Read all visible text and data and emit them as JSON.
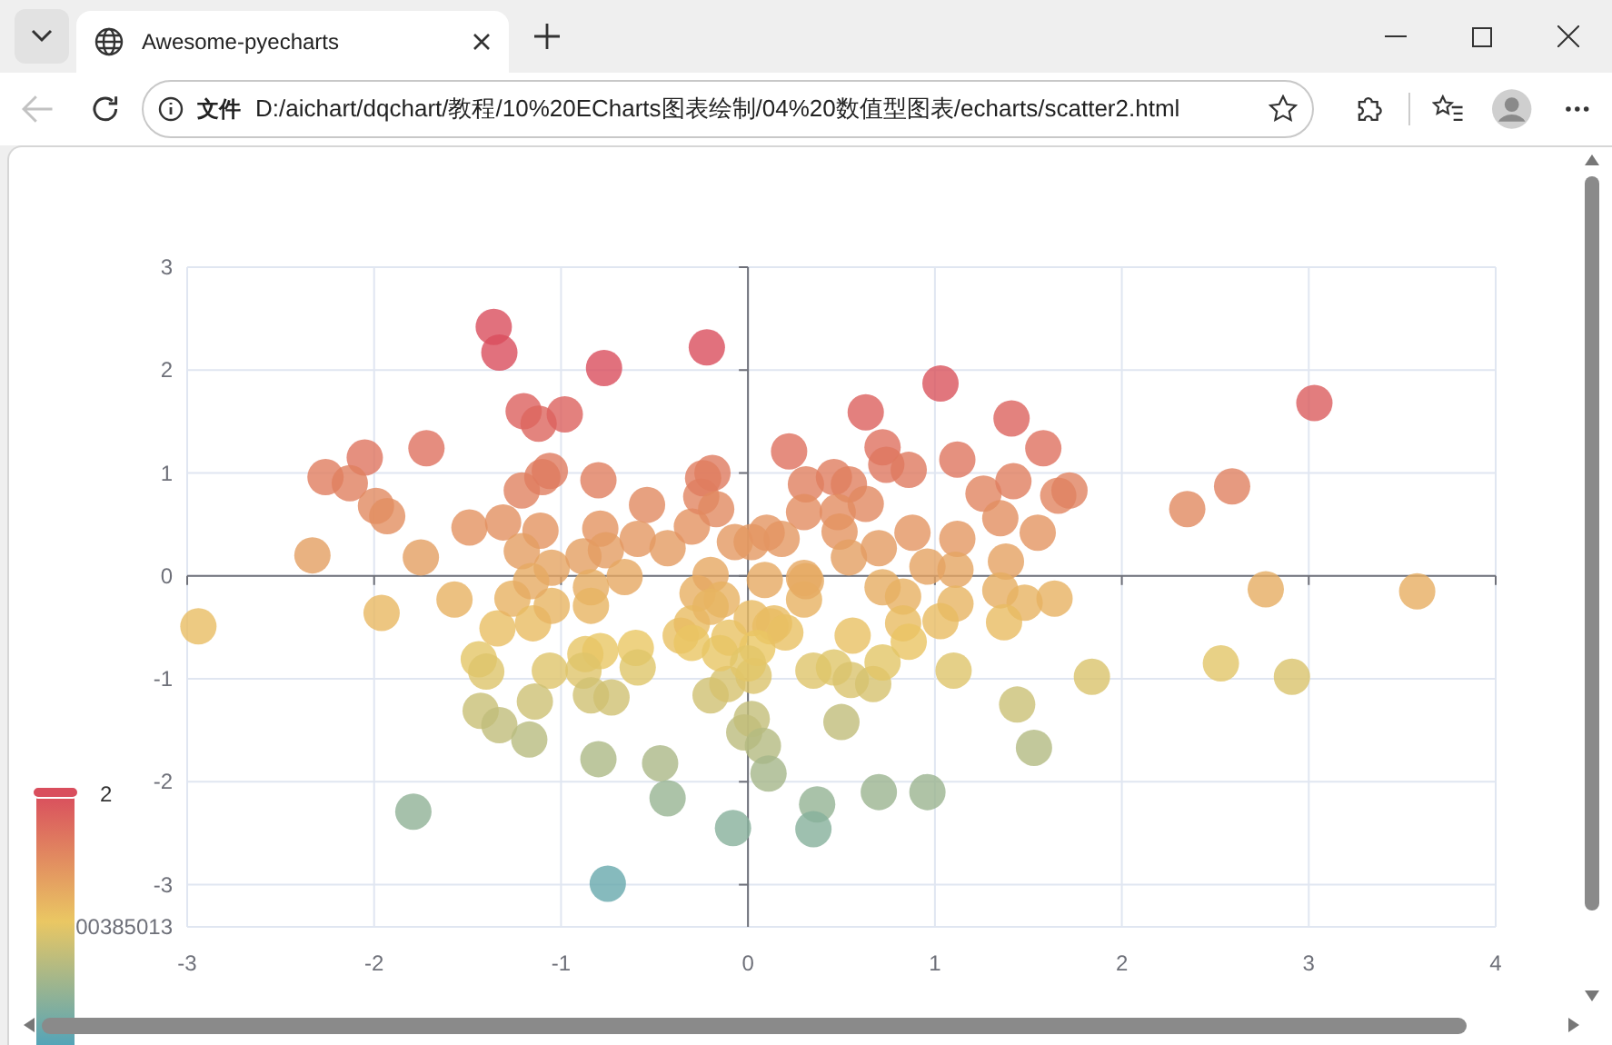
{
  "browser": {
    "tab": {
      "title": "Awesome-pyecharts",
      "selected": true
    },
    "address_bar": {
      "badge": "文件",
      "url": "D:/aichart/dqchart/教程/10%20ECharts图表绘制/04%20数值型图表/echarts/scatter2.html"
    }
  },
  "chart": {
    "visual_map": {
      "label": "2"
    },
    "y_min_label": "00385013",
    "chart_data": {
      "type": "scatter",
      "grid": true,
      "xlim": [
        -3,
        4
      ],
      "ylim": [
        -3.41,
        3
      ],
      "xticks": [
        -3,
        -2,
        -1,
        0,
        1,
        2,
        3,
        4
      ],
      "yticks": [
        -3,
        -2,
        -1,
        0,
        1,
        2,
        3
      ],
      "x": [
        -1.36,
        -1.33,
        -0.77,
        -0.22,
        -1.2,
        -1.12,
        -0.98,
        -2.05,
        -1.72,
        -2.26,
        -2.13,
        -1.99,
        -1.93,
        -2.33,
        -1.75,
        -1.49,
        -1.31,
        -1.21,
        -1.1,
        -1.06,
        -0.8,
        -1.11,
        -1.21,
        -1.05,
        -0.88,
        -0.79,
        -0.76,
        -0.66,
        -0.54,
        -0.59,
        -0.43,
        -0.3,
        -0.25,
        -0.19,
        -0.24,
        -0.17,
        -0.07,
        0.02,
        0.22,
        0.31,
        0.3,
        0.18,
        0.09,
        0.3,
        0.3,
        -2.94,
        -1.96,
        -1.57,
        -1.34,
        -1.26,
        -1.15,
        -1.05,
        -1.16,
        -0.84,
        -0.84,
        -0.27,
        -0.2,
        -0.14,
        0.14,
        0.02,
        -0.36,
        -0.3,
        -0.6,
        -0.79,
        -0.87,
        -1.44,
        -1.4,
        -1.06,
        -0.59,
        0.56,
        0.35,
        1.03,
        3.03,
        0.63,
        1.41,
        1.58,
        0.72,
        0.74,
        0.86,
        1.12,
        0.46,
        0.54,
        0.63,
        1.26,
        1.42,
        1.66,
        1.72,
        1.35,
        1.55,
        2.35,
        2.59,
        0.48,
        0.49,
        0.1,
        0.54,
        0.88,
        1.12,
        1.38,
        0.7,
        1.11,
        0.96,
        0.31,
        0.72,
        0.83,
        1.35,
        1.48,
        1.64,
        2.77,
        3.58,
        1.11,
        1.37,
        1.03,
        0.83,
        0.86,
        0.12,
        1.1,
        1.84,
        2.53,
        2.91,
        0.46,
        -0.88,
        -0.2,
        -0.11,
        0.03,
        0.55,
        0.67,
        0.72,
        -1.43,
        -1.33,
        -1.14,
        -1.17,
        -0.84,
        -0.73,
        -0.02,
        0.02,
        0.08,
        0.11,
        0.5,
        1.44,
        1.53,
        -0.8,
        -0.47,
        -0.43,
        -1.79,
        -0.08,
        0.37,
        0.35,
        0.7,
        0.96,
        -0.75,
        -0.2,
        -0.1,
        0.05,
        -0.3,
        -0.15,
        0,
        0.2
      ],
      "series": [
        {
          "values": [
            2.42,
            2.17,
            2.02,
            2.22,
            1.6,
            1.48,
            1.57,
            1.15,
            1.24,
            0.96,
            0.9,
            0.68,
            0.58,
            0.2,
            0.18,
            0.47,
            0.52,
            0.83,
            0.96,
            1.02,
            0.93,
            0.44,
            0.24,
            0.08,
            0.19,
            0.46,
            0.25,
            -0.01,
            0.69,
            0.36,
            0.27,
            0.48,
            0.77,
            1,
            0.95,
            0.65,
            0.33,
            0.33,
            1.21,
            0.89,
            0.62,
            0.36,
            -0.04,
            -0.02,
            -0.23,
            -0.49,
            -0.36,
            -0.23,
            -0.51,
            -0.22,
            -0.46,
            -0.29,
            -0.05,
            -0.11,
            -0.29,
            -0.17,
            0.01,
            -0.23,
            -0.46,
            -0.41,
            -0.58,
            -0.46,
            -0.7,
            -0.73,
            -0.76,
            -0.81,
            -0.93,
            -0.92,
            -0.89,
            -0.58,
            -0.92,
            1.87,
            1.68,
            1.59,
            1.53,
            1.24,
            1.25,
            1.08,
            1.03,
            1.13,
            0.96,
            0.89,
            0.7,
            0.8,
            0.92,
            0.78,
            0.83,
            0.56,
            0.42,
            0.65,
            0.87,
            0.62,
            0.43,
            0.42,
            0.18,
            0.42,
            0.36,
            0.14,
            0.27,
            0.06,
            0.09,
            -0.05,
            -0.11,
            -0.2,
            -0.14,
            -0.26,
            -0.22,
            -0.13,
            -0.15,
            -0.27,
            -0.45,
            -0.44,
            -0.46,
            -0.64,
            -0.49,
            -0.92,
            -0.98,
            -0.85,
            -0.98,
            -0.89,
            -0.92,
            -1.16,
            -1.05,
            -0.97,
            -1.01,
            -1.05,
            -0.84,
            -1.31,
            -1.45,
            -1.22,
            -1.59,
            -1.16,
            -1.18,
            -1.52,
            -1.39,
            -1.65,
            -1.92,
            -1.42,
            -1.25,
            -1.67,
            -1.78,
            -1.82,
            -2.16,
            -2.29,
            -2.45,
            -2.22,
            -2.46,
            -2.1,
            -2.1,
            -2.99,
            -0.3,
            -0.6,
            -0.7,
            -0.65,
            -0.75,
            -0.85,
            -0.55
          ]
        }
      ]
    }
  }
}
